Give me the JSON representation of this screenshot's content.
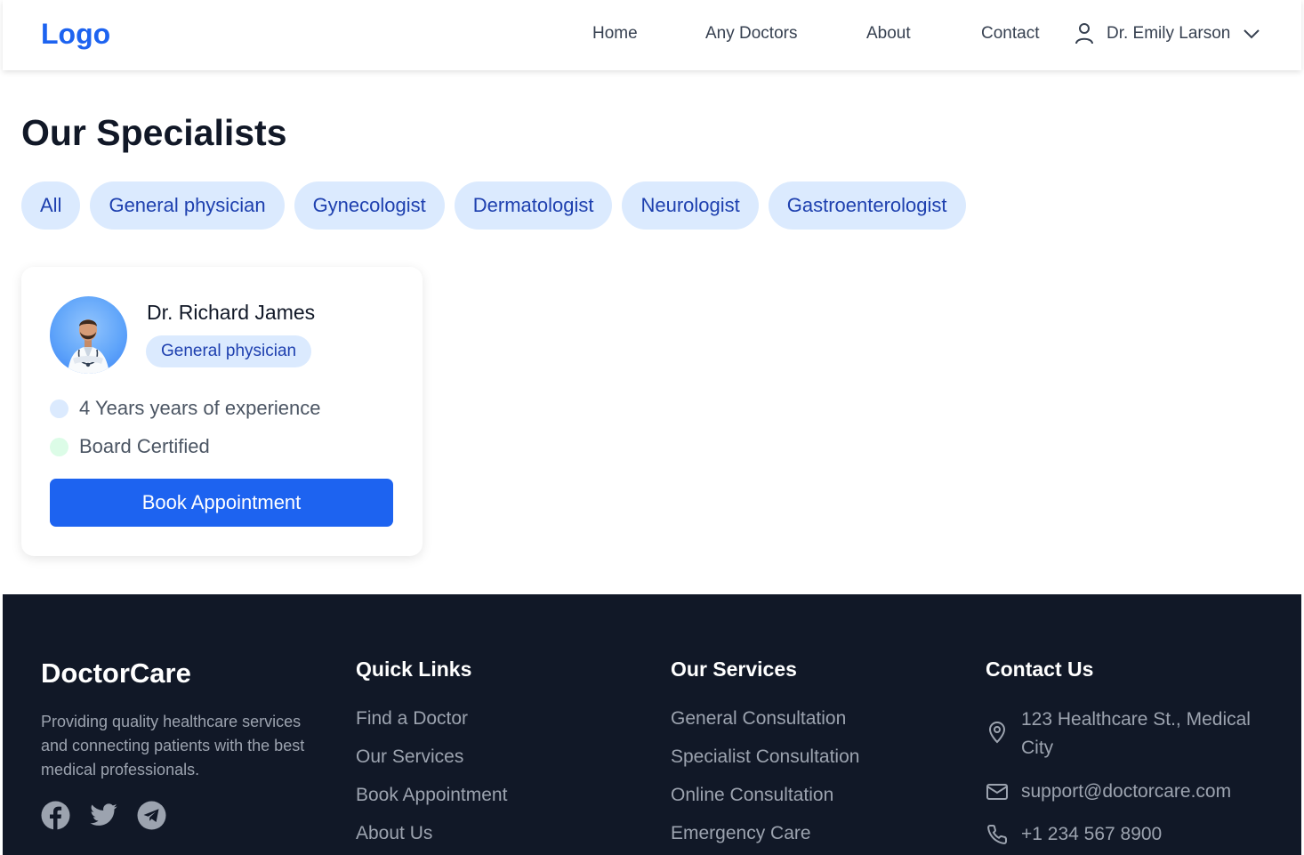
{
  "header": {
    "logo": "Logo",
    "nav": [
      "Home",
      "Any Doctors",
      "About",
      "Contact"
    ],
    "user_name": "Dr. Emily Larson"
  },
  "main": {
    "title": "Our Specialists",
    "filters": [
      "All",
      "General physician",
      "Gynecologist",
      "Dermatologist",
      "Neurologist",
      "Gastroenterologist"
    ],
    "doctor": {
      "name": "Dr. Richard James",
      "specialty": "General physician",
      "experience": "4 Years years of experience",
      "certification": "Board Certified",
      "book_label": "Book Appointment"
    }
  },
  "footer": {
    "brand": "DoctorCare",
    "tagline": "Providing quality healthcare services and connecting patients with the best medical professionals.",
    "quick_links": {
      "title": "Quick Links",
      "items": [
        "Find a Doctor",
        "Our Services",
        "Book Appointment",
        "About Us"
      ]
    },
    "services": {
      "title": "Our Services",
      "items": [
        "General Consultation",
        "Specialist Consultation",
        "Online Consultation",
        "Emergency Care"
      ]
    },
    "contact": {
      "title": "Contact Us",
      "address": "123 Healthcare St., Medical City",
      "email": "support@doctorcare.com",
      "phone": "+1 234 567 8900"
    },
    "socials": [
      "facebook-icon",
      "twitter-icon",
      "telegram-icon"
    ]
  },
  "colors": {
    "accent": "#1d63f0",
    "chip_bg": "#dbeafe",
    "chip_text": "#1e40af",
    "footer_bg": "#111827"
  }
}
